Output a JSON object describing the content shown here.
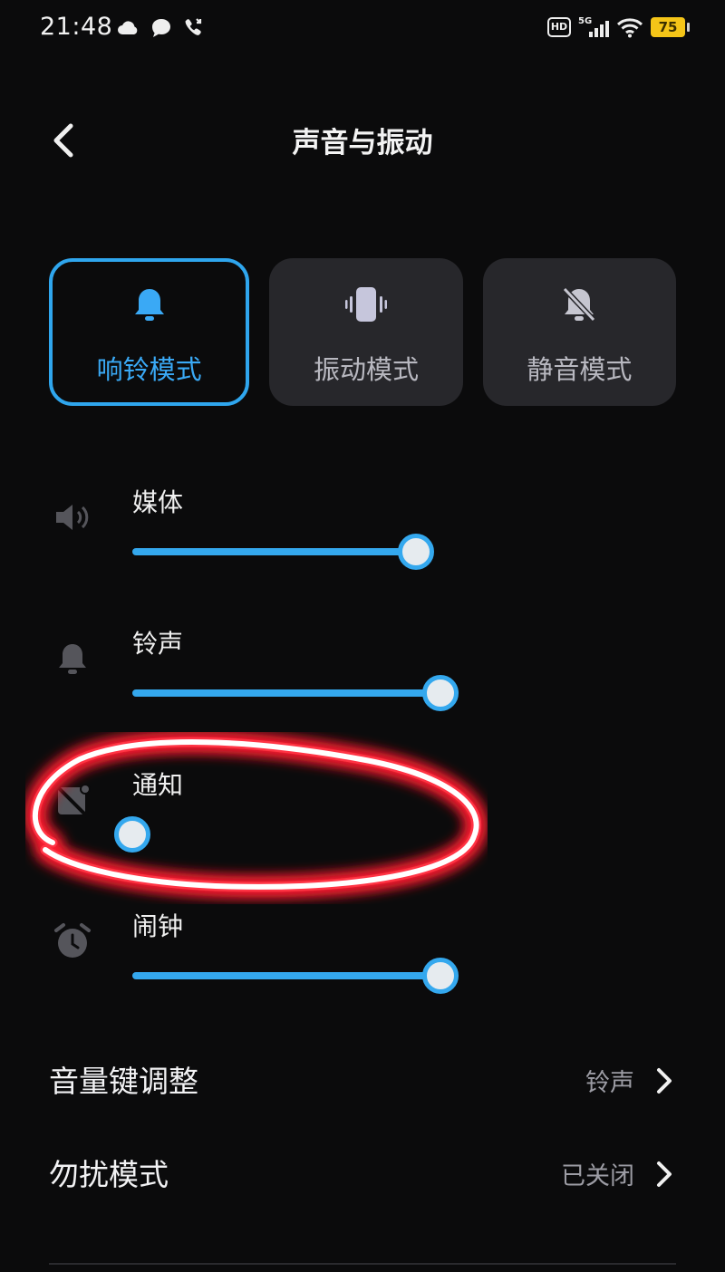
{
  "status_bar": {
    "time": "21:48",
    "hd": "HD",
    "network": "5G",
    "battery": "75"
  },
  "header": {
    "title": "声音与振动",
    "back_icon": "chevron-left-icon"
  },
  "modes": [
    {
      "label": "响铃模式",
      "icon": "bell-icon",
      "active": true
    },
    {
      "label": "振动模式",
      "icon": "phone-vibrate-icon",
      "active": false
    },
    {
      "label": "静音模式",
      "icon": "bell-off-icon",
      "active": false
    }
  ],
  "volumes": [
    {
      "label": "媒体",
      "icon": "speaker-icon",
      "level": 0.92
    },
    {
      "label": "铃声",
      "icon": "bell-icon",
      "level": 1.0
    },
    {
      "label": "通知",
      "icon": "notification-muted-icon",
      "level": 0.0
    },
    {
      "label": "闹钟",
      "icon": "alarm-clock-icon",
      "level": 1.0
    }
  ],
  "settings": [
    {
      "title": "音量键调整",
      "value": "铃声"
    },
    {
      "title": "勿扰模式",
      "value": "已关闭"
    }
  ],
  "colors": {
    "accent": "#34a8ee",
    "background": "#0b0b0c",
    "card": "#27272b",
    "highlight": "#ff2030"
  }
}
